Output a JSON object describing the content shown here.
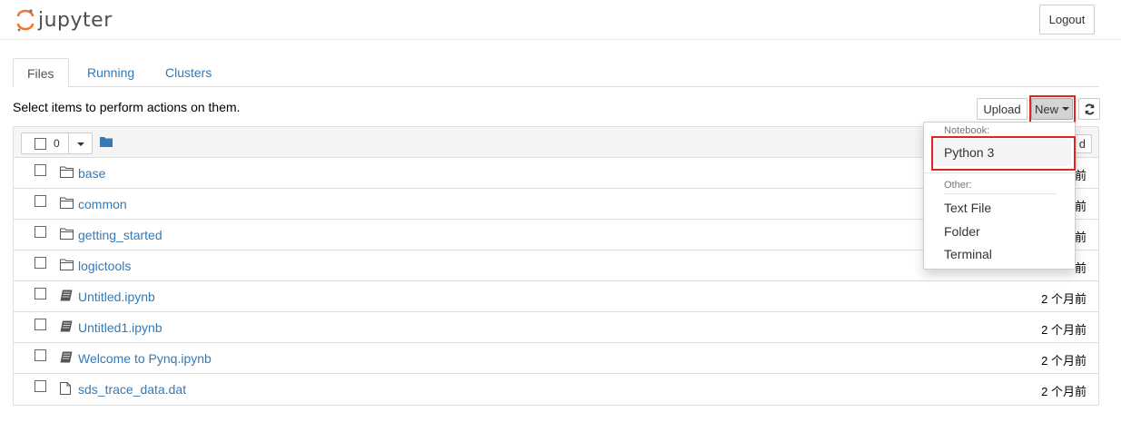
{
  "header": {
    "logo_text": "jupyter",
    "logout_label": "Logout"
  },
  "tabs": [
    {
      "label": "Files",
      "active": true
    },
    {
      "label": "Running",
      "active": false
    },
    {
      "label": "Clusters",
      "active": false
    }
  ],
  "hint": "Select items to perform actions on them.",
  "toolbar": {
    "upload_label": "Upload",
    "new_label": "New",
    "refresh_icon": "refresh-icon"
  },
  "list_header": {
    "selected_count": "0",
    "partial_button_text": "d"
  },
  "files": [
    {
      "name": "base",
      "type": "folder",
      "modified": "前"
    },
    {
      "name": "common",
      "type": "folder",
      "modified": "前"
    },
    {
      "name": "getting_started",
      "type": "folder",
      "modified": "前"
    },
    {
      "name": "logictools",
      "type": "folder",
      "modified": "前"
    },
    {
      "name": "Untitled.ipynb",
      "type": "notebook",
      "modified": "2 个月前"
    },
    {
      "name": "Untitled1.ipynb",
      "type": "notebook",
      "modified": "2 个月前"
    },
    {
      "name": "Welcome to Pynq.ipynb",
      "type": "notebook",
      "modified": "2 个月前"
    },
    {
      "name": "sds_trace_data.dat",
      "type": "file",
      "modified": "2 个月前"
    }
  ],
  "new_menu": {
    "notebook_header": "Notebook:",
    "python3": "Python 3",
    "other_header": "Other:",
    "text_file": "Text File",
    "folder": "Folder",
    "terminal": "Terminal"
  },
  "colors": {
    "link": "#337ab7",
    "highlight": "#e32222",
    "logo_orange": "#f37626"
  }
}
